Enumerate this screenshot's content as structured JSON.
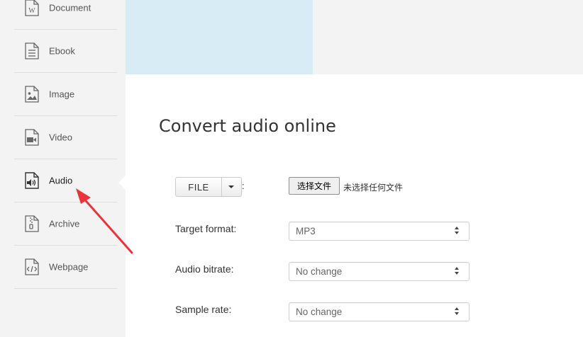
{
  "sidebar": {
    "items": [
      {
        "label": "Document",
        "icon": "word-document-icon"
      },
      {
        "label": "Ebook",
        "icon": "ebook-icon"
      },
      {
        "label": "Image",
        "icon": "image-icon"
      },
      {
        "label": "Video",
        "icon": "video-icon"
      },
      {
        "label": "Audio",
        "icon": "audio-icon",
        "active": true
      },
      {
        "label": "Archive",
        "icon": "archive-icon"
      },
      {
        "label": "Webpage",
        "icon": "webpage-icon"
      }
    ]
  },
  "main": {
    "title": "Convert audio online",
    "file_source": {
      "button_label": "FILE",
      "colon": ":",
      "choose_label": "选择文件",
      "no_file_text": "未选择任何文件"
    },
    "fields": [
      {
        "label": "Target format:",
        "value": "MP3"
      },
      {
        "label": "Audio bitrate:",
        "value": "No change"
      },
      {
        "label": "Sample rate:",
        "value": "No change"
      }
    ]
  },
  "colors": {
    "sidebar_bg": "#f3f3f3",
    "banner_blue": "#d8ecf5",
    "annotation_arrow": "#e8353b"
  }
}
